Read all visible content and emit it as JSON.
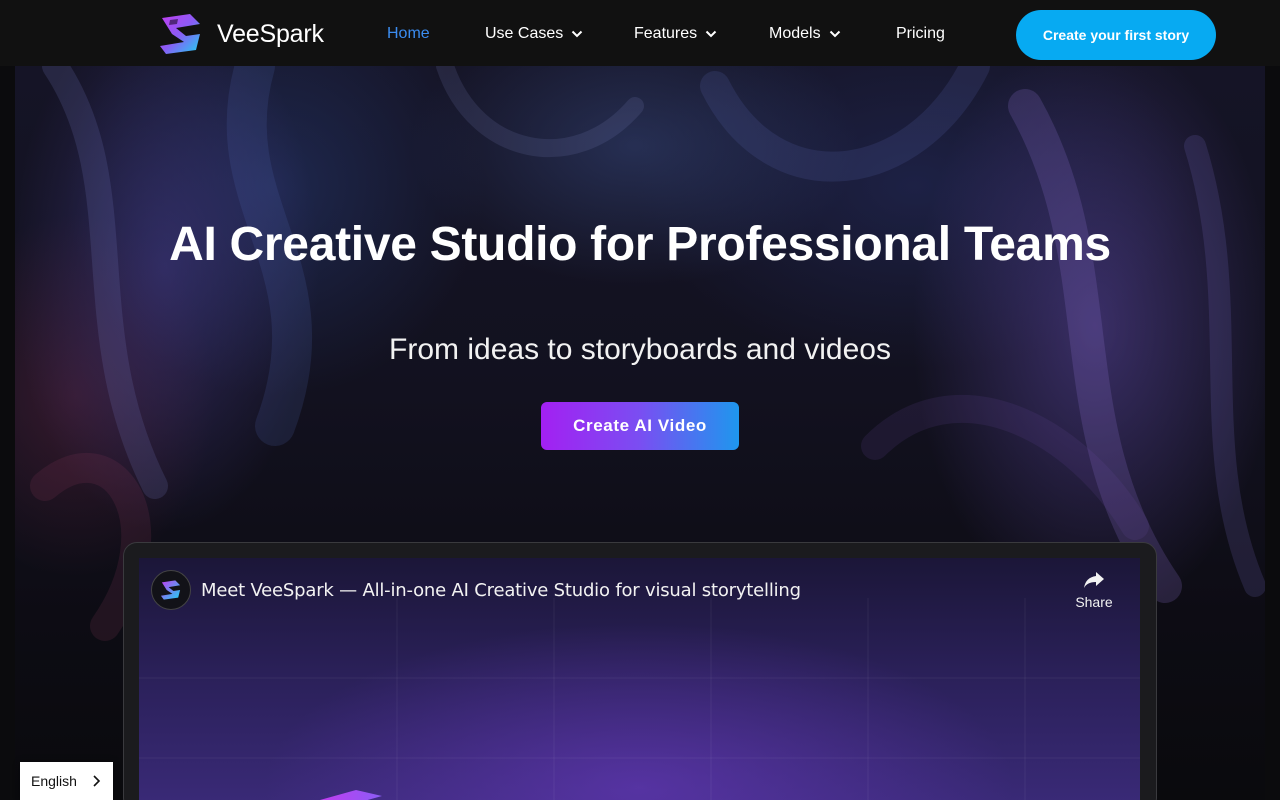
{
  "header": {
    "brand": "VeeSpark",
    "nav": [
      {
        "label": "Home",
        "active": true,
        "has_dropdown": false
      },
      {
        "label": "Use Cases",
        "active": false,
        "has_dropdown": true
      },
      {
        "label": "Features",
        "active": false,
        "has_dropdown": true
      },
      {
        "label": "Models",
        "active": false,
        "has_dropdown": true
      },
      {
        "label": "Pricing",
        "active": false,
        "has_dropdown": false
      }
    ],
    "cta_label": "Create your first story"
  },
  "hero": {
    "title": "AI Creative Studio for Professional Teams",
    "subtitle": "From ideas to storyboards and videos",
    "cta_label": "Create AI Video"
  },
  "video": {
    "title": "Meet VeeSpark — All-in-one AI Creative Studio for visual storytelling",
    "share_label": "Share"
  },
  "language": {
    "selected": "English"
  },
  "colors": {
    "accent_blue": "#07aaf2",
    "nav_active": "#3b8cf0",
    "cta_gradient_start": "#a320f2",
    "cta_gradient_end": "#1e97ee",
    "header_bg": "#111111"
  },
  "icons": {
    "logo": "veespark-logo-icon",
    "dropdown": "chevron-down-icon",
    "share": "share-arrow-icon",
    "language": "chevron-right-icon"
  }
}
